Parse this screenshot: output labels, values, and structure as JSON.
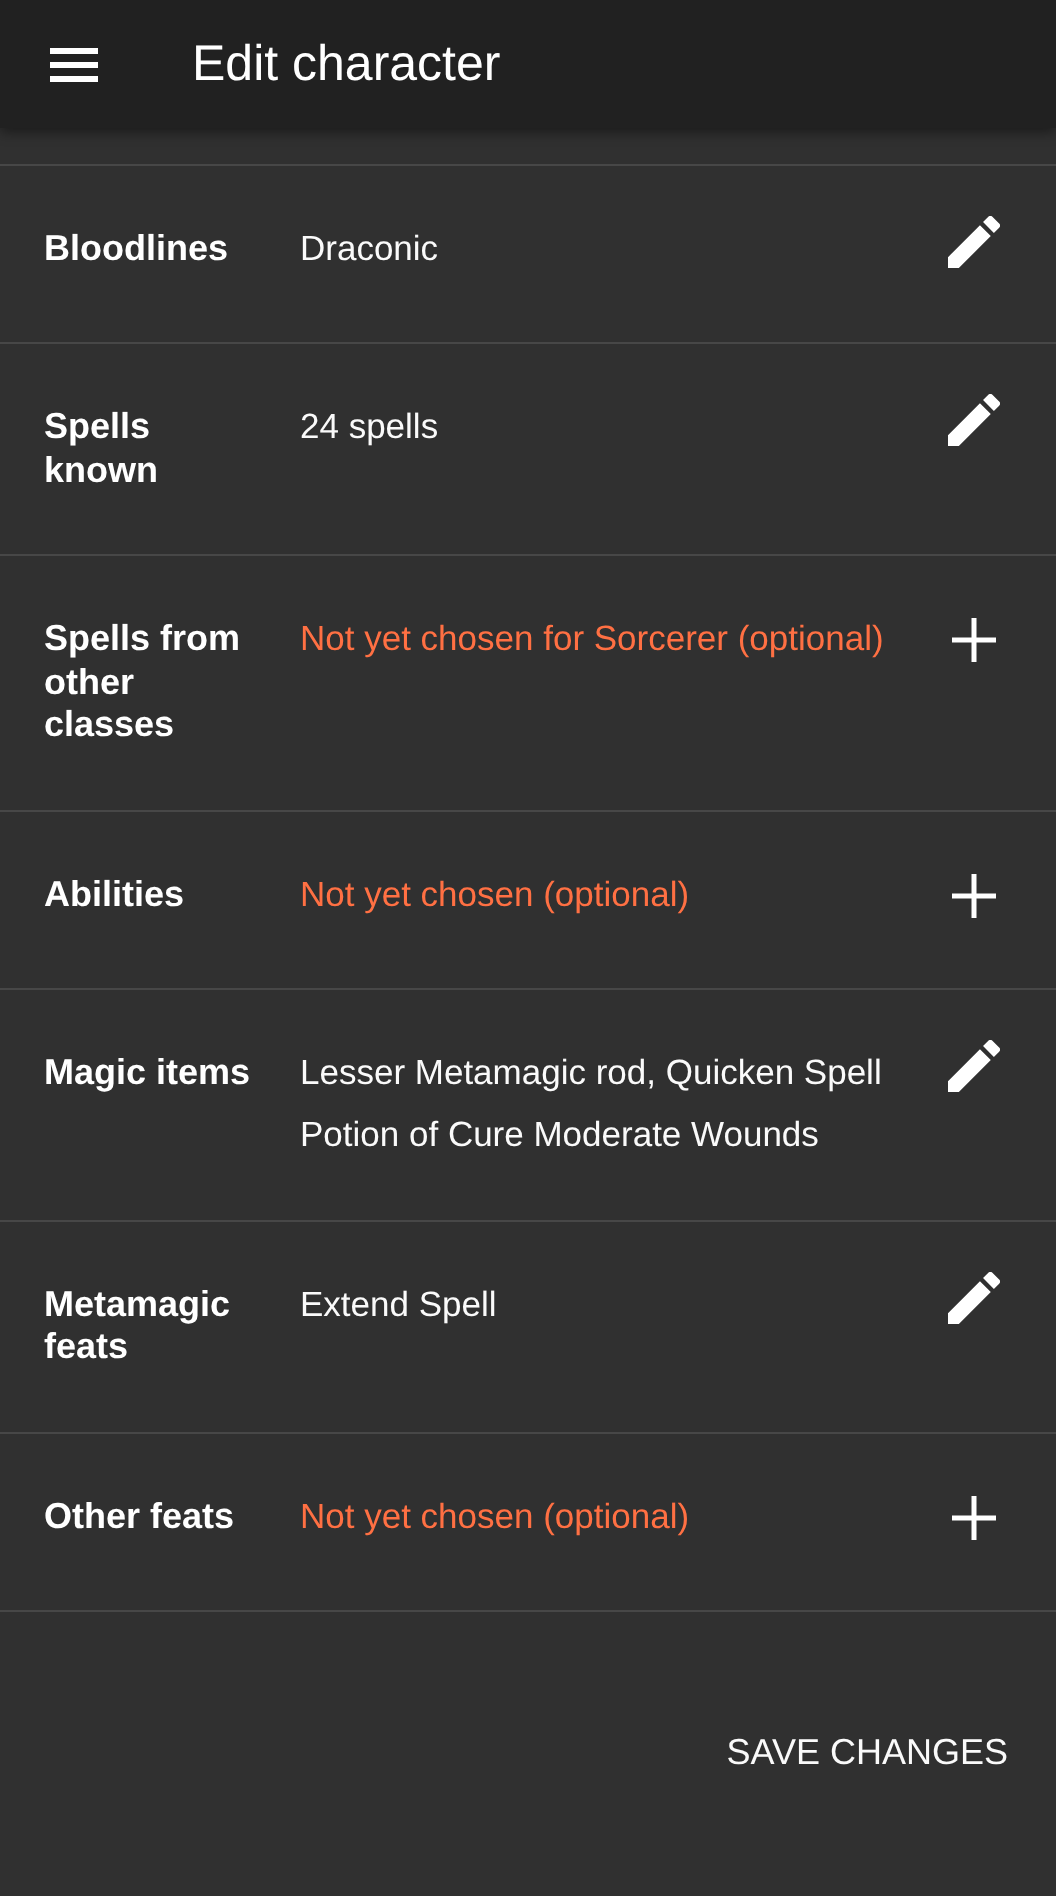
{
  "app_bar": {
    "title": "Edit character"
  },
  "rows": [
    {
      "label": "Bloodlines",
      "kind": "set",
      "values": [
        "Draconic"
      ]
    },
    {
      "label": "Spells known",
      "kind": "set",
      "values": [
        "24 spells"
      ]
    },
    {
      "label": "Spells from other classes",
      "kind": "empty",
      "values": [
        "Not yet chosen for Sorcerer (optional)"
      ]
    },
    {
      "label": "Abilities",
      "kind": "empty",
      "values": [
        "Not yet chosen (optional)"
      ]
    },
    {
      "label": "Magic items",
      "kind": "set",
      "values": [
        "Lesser Metamagic rod, Quicken Spell",
        "Potion of Cure Moderate Wounds"
      ]
    },
    {
      "label": "Metamagic feats",
      "kind": "set",
      "values": [
        "Extend Spell"
      ]
    },
    {
      "label": "Other feats",
      "kind": "empty",
      "values": [
        "Not yet chosen (optional)"
      ]
    }
  ],
  "footer": {
    "button": "SAVE CHANGES"
  }
}
